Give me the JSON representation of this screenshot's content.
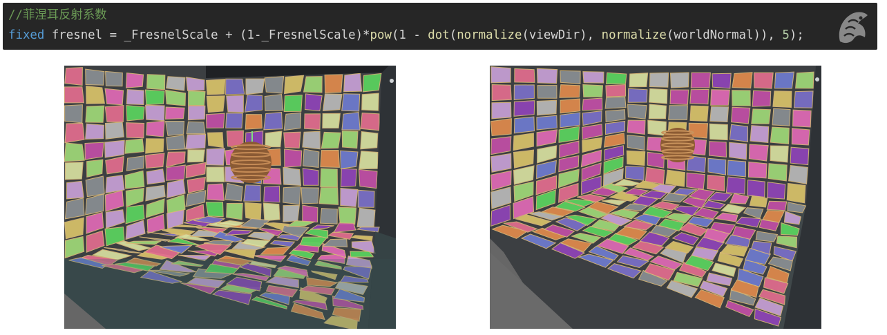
{
  "code": {
    "comment": "//菲涅耳反射系数",
    "line": {
      "type_kw": "fixed",
      "var": " fresnel = _FresnelScale + (1-_FresnelScale)*",
      "pow": "pow",
      "p1": "(1 - ",
      "dot": "dot",
      "p2": "(",
      "normalize1": "normalize",
      "p3": "(viewDir), ",
      "normalize2": "normalize",
      "p4": "(worldNormal)), ",
      "exp": "5",
      "p5": ");"
    }
  },
  "palette": {
    "tiles": [
      "#c24fa6",
      "#e06ab6",
      "#8f44b8",
      "#5bd45f",
      "#9fd878",
      "#e08a4c",
      "#d9c36a",
      "#b9b9b9",
      "#8a8f93",
      "#6e7bd0",
      "#d8e0a0",
      "#e26d8f",
      "#7a6fc8",
      "#c7a0d6"
    ],
    "grout": "#d9b878",
    "floor_dark": "#5a5a5a",
    "wall_dark": "#2e3236"
  }
}
